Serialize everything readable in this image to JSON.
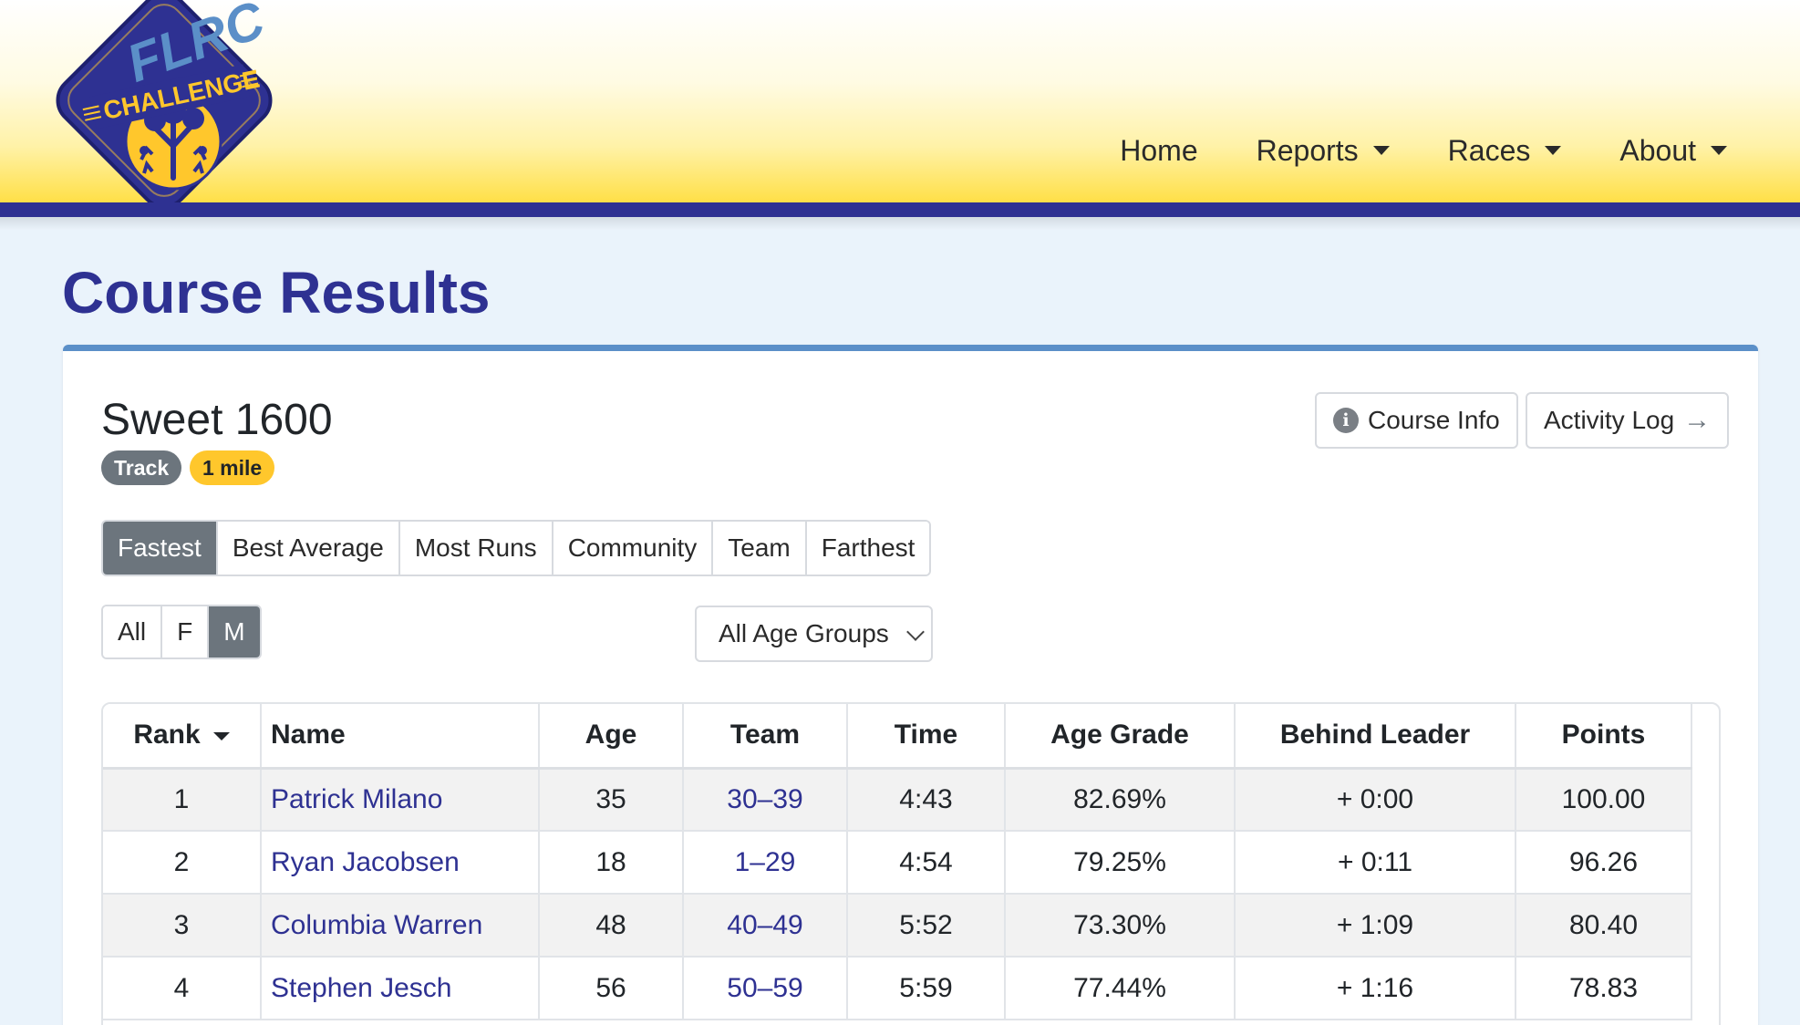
{
  "logo": {
    "top_text": "FLRC",
    "banner_text": "CHALLENGE"
  },
  "nav": {
    "home": "Home",
    "reports": "Reports",
    "races": "Races",
    "about": "About"
  },
  "page_title": "Course Results",
  "course": {
    "name": "Sweet 1600",
    "badges": [
      "Track",
      "1 mile"
    ],
    "course_info_label": "Course Info",
    "activity_log_label": "Activity Log"
  },
  "tabs": [
    {
      "label": "Fastest",
      "active": true
    },
    {
      "label": "Best Average",
      "active": false
    },
    {
      "label": "Most Runs",
      "active": false
    },
    {
      "label": "Community",
      "active": false
    },
    {
      "label": "Team",
      "active": false
    },
    {
      "label": "Farthest",
      "active": false
    }
  ],
  "gender_filter": [
    {
      "label": "All",
      "active": false
    },
    {
      "label": "F",
      "active": false
    },
    {
      "label": "M",
      "active": true
    }
  ],
  "age_group_select": "All Age Groups",
  "table": {
    "headers": [
      "Rank",
      "Name",
      "Age",
      "Team",
      "Time",
      "Age Grade",
      "Behind Leader",
      "Points"
    ],
    "rows": [
      {
        "rank": "1",
        "name": "Patrick Milano",
        "age": "35",
        "team": "30–39",
        "time": "4:43",
        "age_grade": "82.69%",
        "behind": "+ 0:00",
        "points": "100.00"
      },
      {
        "rank": "2",
        "name": "Ryan Jacobsen",
        "age": "18",
        "team": "1–29",
        "time": "4:54",
        "age_grade": "79.25%",
        "behind": "+ 0:11",
        "points": "96.26"
      },
      {
        "rank": "3",
        "name": "Columbia Warren",
        "age": "48",
        "team": "40–49",
        "time": "5:52",
        "age_grade": "73.30%",
        "behind": "+ 1:09",
        "points": "80.40"
      },
      {
        "rank": "4",
        "name": "Stephen Jesch",
        "age": "56",
        "team": "50–59",
        "time": "5:59",
        "age_grade": "77.44%",
        "behind": "+ 1:16",
        "points": "78.83"
      }
    ]
  },
  "colors": {
    "brand_navy": "#2e3192",
    "brand_yellow": "#ffc72c",
    "card_accent": "#5b8fc8"
  }
}
